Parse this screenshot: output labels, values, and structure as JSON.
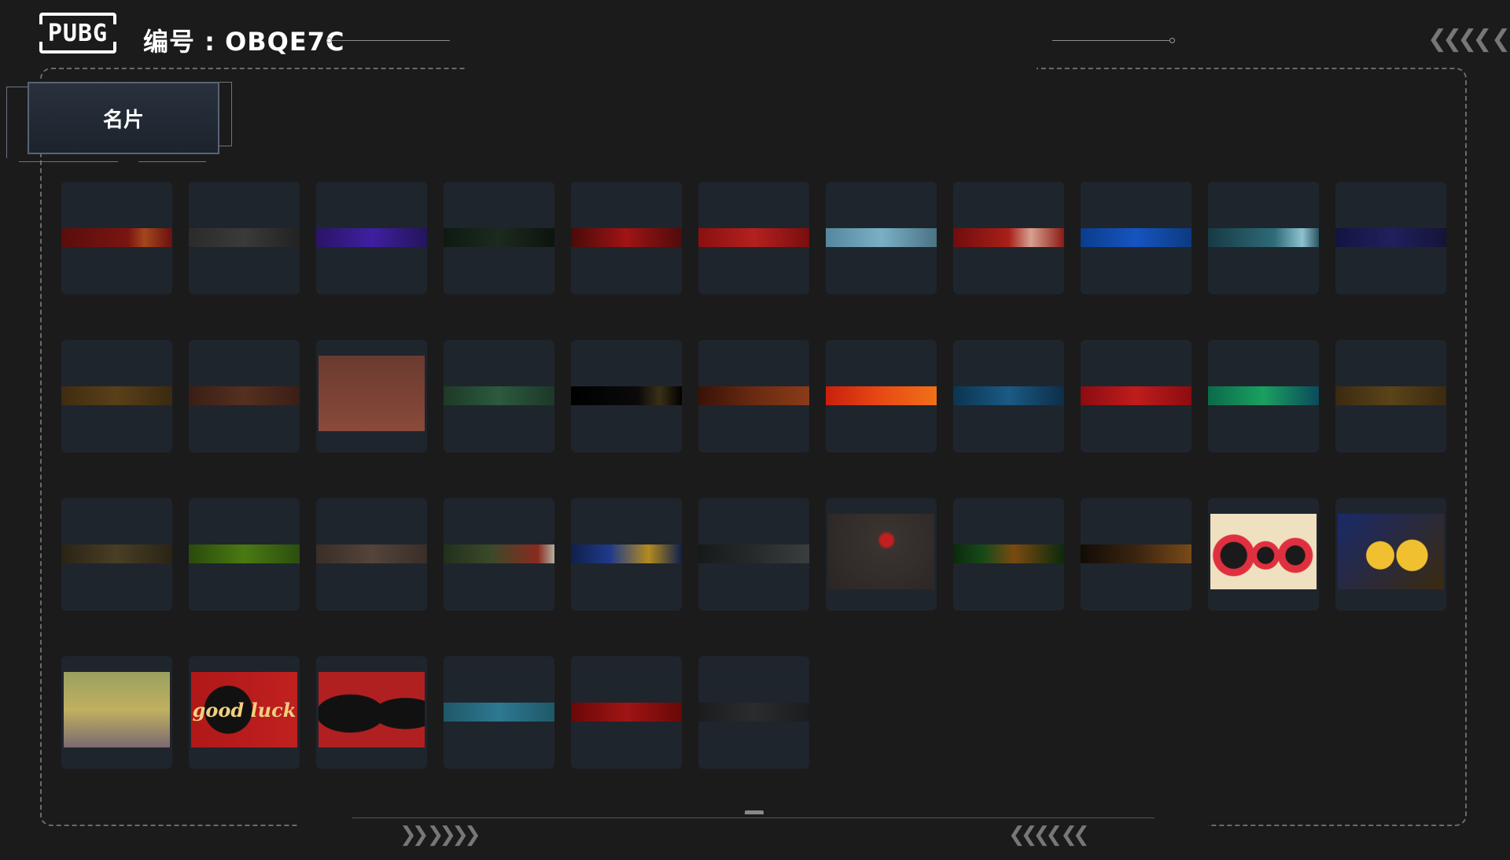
{
  "header": {
    "logo_text": "PUBG",
    "id_label": "编号 : OBQE7C"
  },
  "tab": {
    "label": "名片"
  },
  "decor": {
    "chevrons_right": "❮❮❮❮ ❮",
    "bottom_left_chevrons": "❯❯ ❯❯❯❯",
    "bottom_right_chevrons": "❮❮❮❮ ❮❮"
  },
  "cards": [
    {
      "band": "linear-gradient(90deg,#5a0d0d,#7a1510 60%,#a3461d 75%,#6a1010)"
    },
    {
      "band": "linear-gradient(90deg,#2b2b2b,#3a3a3a,#222)"
    },
    {
      "band": "linear-gradient(90deg,#2a1466,#3f1fa0,#23155a)"
    },
    {
      "band": "linear-gradient(90deg,#0e1a12,#1c2a1e,#0c140e)"
    },
    {
      "band": "linear-gradient(90deg,#4a0a0a,#a01414,#500b0b)"
    },
    {
      "band": "linear-gradient(90deg,#8a1010,#b42020,#7a0e0e)"
    },
    {
      "band": "linear-gradient(90deg,#55879e,#7ab0c6,#4b7384)"
    },
    {
      "band": "linear-gradient(90deg,#700d0d,#a82018 50%,#d8a090 70%,#8a1a14)"
    },
    {
      "band": "linear-gradient(90deg,#0c3c8c,#1555c0,#0c3a80)"
    },
    {
      "band": "linear-gradient(90deg,#173a44,#2f6b78 60%,#8ec2cf 85%,#2a5560)"
    },
    {
      "band": "linear-gradient(90deg,#141440,#20205e,#141438)"
    },
    {
      "band": "linear-gradient(90deg,#3f2c10,#5a4018,#3a2a10)"
    },
    {
      "band": "linear-gradient(90deg,#3a1e16,#55301e,#3a1e16)"
    },
    {
      "image": "wolf"
    },
    {
      "band": "linear-gradient(90deg,#1e3a28,#2c5a3e,#1c3828)"
    },
    {
      "band": "linear-gradient(90deg,#000,#0a0a0a 60%,#3a3015,#000)"
    },
    {
      "band": "linear-gradient(90deg,#3a1206,#6a2a12,#8a3c18)"
    },
    {
      "band": "linear-gradient(90deg,#c8200c,#e84a14,#f07018)"
    },
    {
      "band": "linear-gradient(90deg,#0c3450,#1a5a84,#0c2e48)"
    },
    {
      "band": "linear-gradient(90deg,#8c0c10,#c01c1c,#8c0c10)"
    },
    {
      "band": "linear-gradient(90deg,#0b6a4a,#1aa060,#0a4a5a)"
    },
    {
      "band": "linear-gradient(90deg,#3a2a10,#5a4418,#3a2a10)"
    },
    {
      "band": "linear-gradient(90deg,#2a2416,#4a3e24,#2a2416)"
    },
    {
      "band": "linear-gradient(90deg,#2a4a0c,#4a7a12,#2c4e0e)"
    },
    {
      "band": "linear-gradient(90deg,#3a2e28,#54443a,#3a2e28)"
    },
    {
      "band": "linear-gradient(90deg,#22301c,#3a4a28,#8a2a20 85%,#b0b0a0)"
    },
    {
      "band": "linear-gradient(90deg,#10204a,#1e3a8a,#b48a20 70%,#10204a)"
    },
    {
      "band": "linear-gradient(90deg,#161a1a,#262a2a,#3a3e3e)"
    },
    {
      "image": "plague"
    },
    {
      "band": "linear-gradient(90deg,#0a2a0c,#184a18,#7a4a10 55%,#0a2a0c)"
    },
    {
      "band": "linear-gradient(90deg,#120c06,#3a2410,#7a4a18)"
    },
    {
      "image": "speakers"
    },
    {
      "image": "gold88"
    },
    {
      "image": "frog"
    },
    {
      "image": "goodluck",
      "text": "good luck"
    },
    {
      "image": "wolves"
    },
    {
      "band": "linear-gradient(90deg,#1e5868,#2e7890,#1e5868)"
    },
    {
      "band": "linear-gradient(90deg,#6a0808,#a01414,#6a0808)"
    },
    {
      "band": "linear-gradient(90deg,#1a1c1e,#2a2c2e,#1a1c1e)"
    }
  ]
}
